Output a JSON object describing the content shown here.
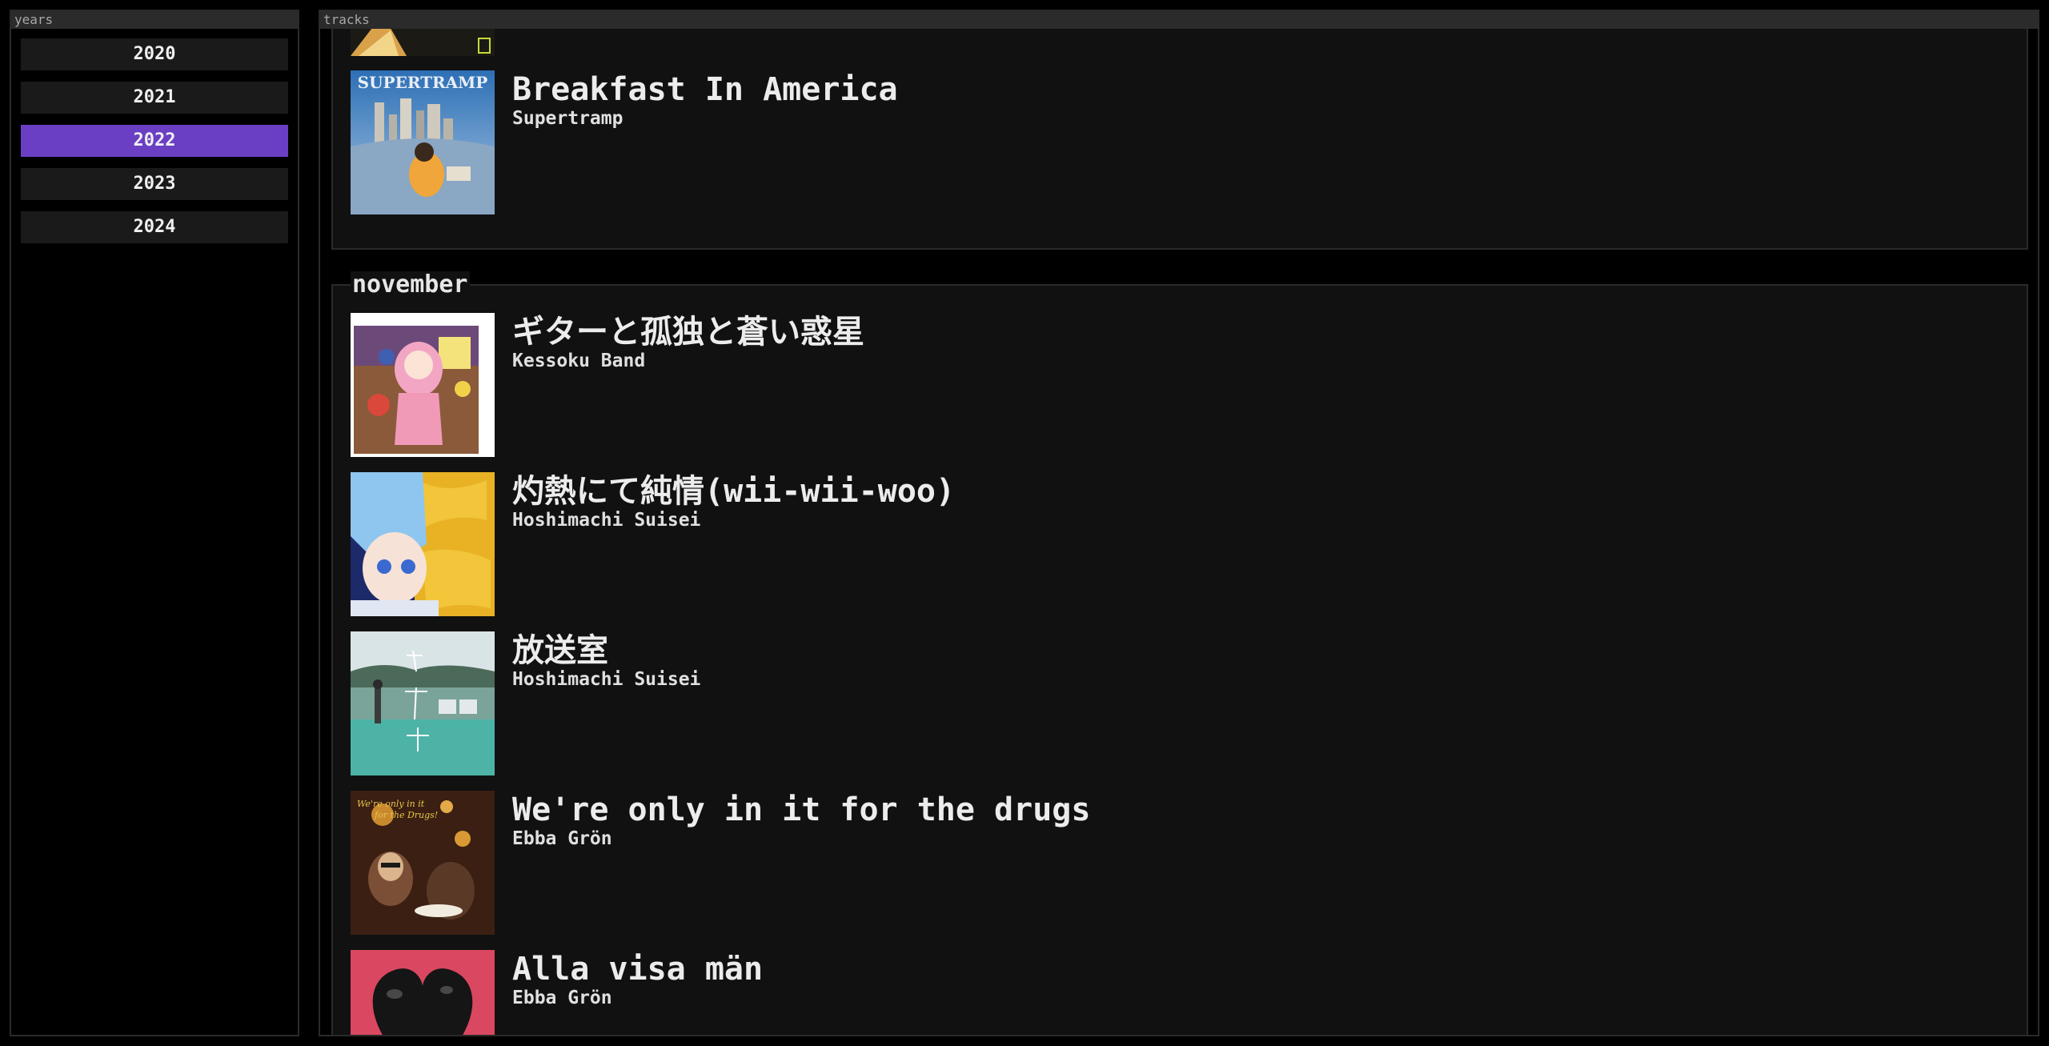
{
  "years_pane": {
    "header": "years",
    "items": [
      {
        "label": "2020",
        "active": false
      },
      {
        "label": "2021",
        "active": false
      },
      {
        "label": "2022",
        "active": true
      },
      {
        "label": "2023",
        "active": false
      },
      {
        "label": "2024",
        "active": false
      }
    ],
    "accent": "#6a3fc4"
  },
  "tracks_pane": {
    "header": "tracks",
    "prev_section": {
      "tracks": [
        {
          "title": "Breakfast In America",
          "artist": "Supertramp",
          "cover_icon": "album-cover-supertramp"
        }
      ]
    },
    "november": {
      "title": "november",
      "tracks": [
        {
          "title": "ギターと孤独と蒼い惑星",
          "artist": "Kessoku Band",
          "cover_icon": "album-cover-kessoku-band"
        },
        {
          "title": "灼熱にて純情(wii-wii-woo)",
          "artist": "Hoshimachi Suisei",
          "cover_icon": "album-cover-suisei-shakunetsu"
        },
        {
          "title": "放送室",
          "artist": "Hoshimachi Suisei",
          "cover_icon": "album-cover-suisei-housoushitsu"
        },
        {
          "title": "We're only in it for the drugs",
          "artist": "Ebba Grön",
          "cover_icon": "album-cover-ebba-gron-drugs"
        },
        {
          "title": "Alla visa män",
          "artist": "Ebba Grön",
          "cover_icon": "album-cover-ebba-gron-alla"
        }
      ]
    }
  }
}
